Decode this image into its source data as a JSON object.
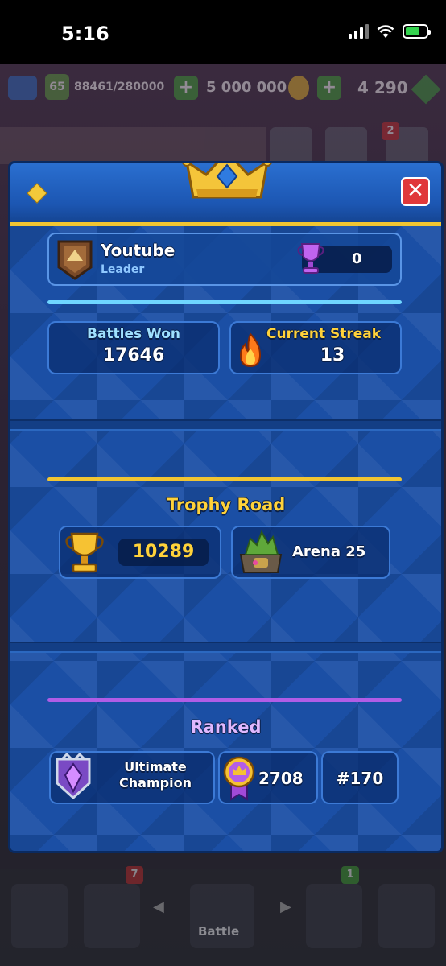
{
  "status_bar": {
    "time": "5:16"
  },
  "background": {
    "level": "65",
    "xp": "88461/280000",
    "gold": "5 000 000",
    "gems": "4 290",
    "shop_badge": "2",
    "cards_badge": "7",
    "clan_badge": "1",
    "battle_label": "Battle"
  },
  "dialog": {
    "player": {
      "name": "Youtube",
      "role": "Leader",
      "clan_trophies": "0"
    },
    "stats": {
      "battles_won_label": "Battles Won",
      "battles_won": "17646",
      "current_streak_label": "Current Streak",
      "current_streak": "13"
    },
    "trophy_road": {
      "title": "Trophy Road",
      "trophies": "10289",
      "arena": "Arena 25"
    },
    "ranked": {
      "title": "Ranked",
      "league_line1": "Ultimate",
      "league_line2": "Champion",
      "rating": "2708",
      "rank": "#170"
    }
  },
  "colors": {
    "header_blue": "#2a6fd0",
    "gold_accent": "#f1c532",
    "cyan_accent": "#6fd6ff",
    "purple_accent": "#b05de6",
    "close_red": "#e0383a"
  }
}
